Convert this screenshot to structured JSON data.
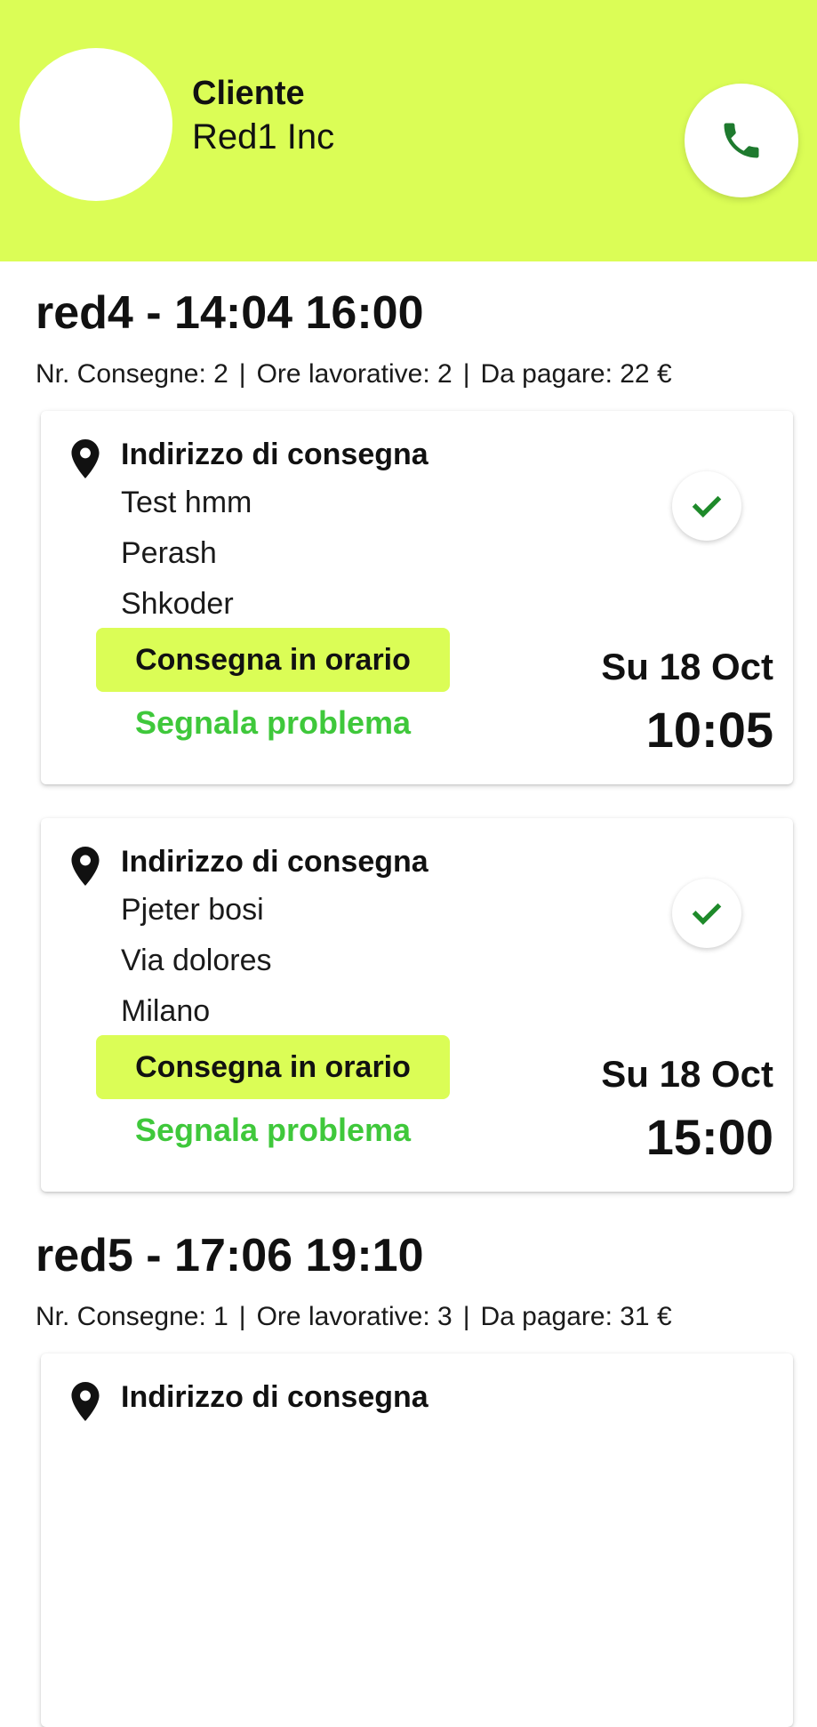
{
  "colors": {
    "accent": "#dbfd56",
    "problem_link": "#3fc83b",
    "check_icon": "#1e8a2a",
    "phone_icon": "#1e7a2e"
  },
  "header": {
    "client_label": "Cliente",
    "client_name": "Red1 Inc",
    "call_icon": "phone-icon"
  },
  "routes": [
    {
      "title": "red4 - 14:04 16:00",
      "stats": {
        "deliveries": "Nr. Consegne: 2",
        "hours": "Ore lavorative: 2",
        "to_pay": "Da pagare: 22 €"
      },
      "deliveries": [
        {
          "heading": "Indirizzo di consegna",
          "address": [
            "Test hmm",
            "Perash",
            "Shkoder"
          ],
          "status_label": "Consegna in orario",
          "report_label": "Segnala problema",
          "date": "Su 18 Oct",
          "time": "10:05"
        },
        {
          "heading": "Indirizzo di consegna",
          "address": [
            "Pjeter bosi",
            "Via dolores",
            "Milano"
          ],
          "status_label": "Consegna in orario",
          "report_label": "Segnala problema",
          "date": "Su 18 Oct",
          "time": "15:00"
        }
      ]
    },
    {
      "title": "red5 - 17:06 19:10",
      "stats": {
        "deliveries": "Nr. Consegne: 1",
        "hours": "Ore lavorative: 3",
        "to_pay": "Da pagare: 31 €"
      },
      "deliveries": [
        {
          "heading": "Indirizzo di consegna"
        }
      ]
    }
  ]
}
